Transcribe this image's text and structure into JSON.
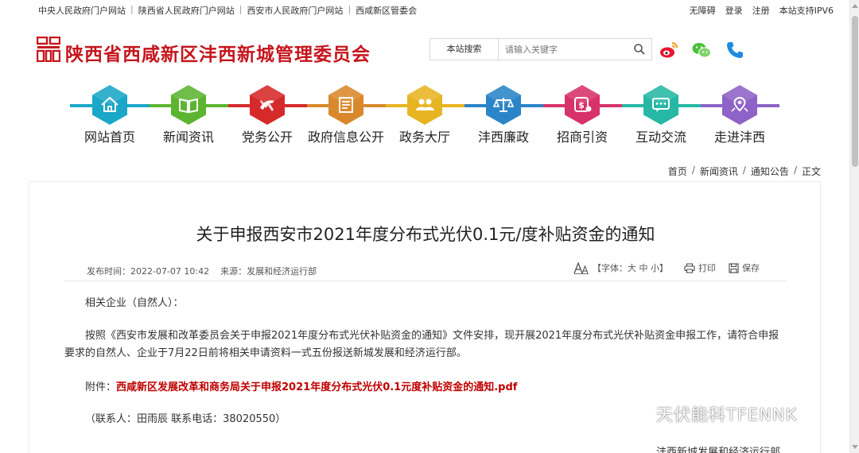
{
  "topbar": {
    "links": [
      "中央人民政府门户网站",
      "陕西省人民政府门户网站",
      "西安市人民政府门户网站",
      "西咸新区管委会"
    ],
    "right_links": [
      "无障碍",
      "登录",
      "注册",
      "本站支持IPV6"
    ]
  },
  "header": {
    "title": "陕西省西咸新区沣西新城管理委员会",
    "search_label": "本站搜索",
    "search_placeholder": "请输入关键字",
    "icons": [
      "weibo-icon",
      "wechat-icon",
      "phone-icon"
    ]
  },
  "nav": {
    "items": [
      {
        "label": "网站首页",
        "icon": "home-icon",
        "color": "#1aa7c8"
      },
      {
        "label": "新闻资讯",
        "icon": "book-icon",
        "color": "#5cb531"
      },
      {
        "label": "党务公开",
        "icon": "party-emblem-icon",
        "color": "#d62a2a"
      },
      {
        "label": "政府信息公开",
        "icon": "document-icon",
        "color": "#d9892b"
      },
      {
        "label": "政务大厅",
        "icon": "people-icon",
        "color": "#e8b422"
      },
      {
        "label": "沣西廉政",
        "icon": "scales-icon",
        "color": "#2a85c8"
      },
      {
        "label": "招商引资",
        "icon": "money-icon",
        "color": "#d8326a"
      },
      {
        "label": "互动交流",
        "icon": "chat-icon",
        "color": "#26b8a4"
      },
      {
        "label": "走进沣西",
        "icon": "location-icon",
        "color": "#8e62c6"
      }
    ]
  },
  "breadcrumb": [
    "首页",
    "新闻资讯",
    "通知公告",
    "正文"
  ],
  "article": {
    "title": "关于申报西安市2021年度分布式光伏0.1元/度补贴资金的通知",
    "publish_time": "发布时间：2022-07-07 10:42",
    "source": "来源：发展和经济运行部",
    "font_size_label": "【字体：大 中 小】",
    "print_label": "打印",
    "save_label": "保存",
    "greeting": "相关企业（自然人）：",
    "body": "按照《西安市发展和改革委员会关于申报2021年度分布式光伏补贴资金的通知》文件安排，现开展2021年度分布式光伏补贴资金申报工作，请符合申报要求的自然人、企业于7月22日前将相关申请资料一式五份报送新城发展和经济运行部。",
    "attachment_label": "附件：",
    "attachment_link": "西咸新区发展改革和商务局关于申报2021年度分布式光伏0.1元度补贴资金的通知.pdf",
    "contact": "（联系人：田雨辰 联系电话：38020550）",
    "signature": "沣西新城发展和经济运行部"
  },
  "watermark": "天伏能科TFENNK"
}
